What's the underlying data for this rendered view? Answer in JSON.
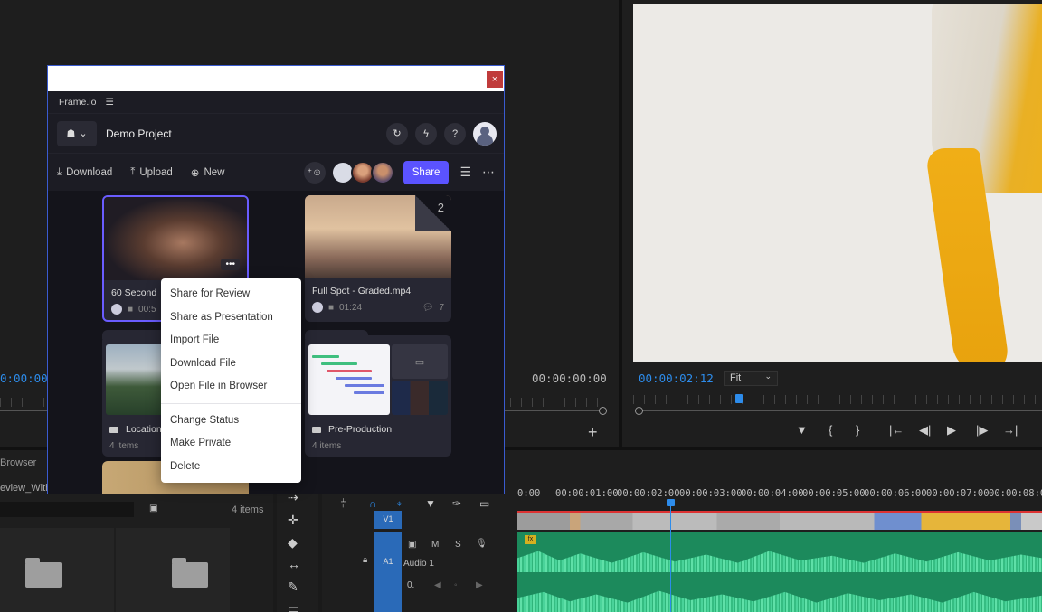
{
  "premiere": {
    "source_timecode": "0:00:00",
    "source_end_timecode": "00:00:00:00",
    "program_timecode": "00:00:02:12",
    "fit_label": "Fit",
    "project_tab": "Browser",
    "project_file": "eview_With",
    "project_count": "4 items",
    "track_v1": "V1",
    "track_a1": "A1",
    "audio_label": "Audio 1",
    "track_m": "M",
    "track_s": "S",
    "fx_label": "fx",
    "ruler": [
      "0:00",
      "00:00:01:00",
      "00:00:02:00",
      "00:00:03:00",
      "00:00:04:00",
      "00:00:05:00",
      "00:00:06:00",
      "00:00:07:00",
      "00:00:08:00"
    ]
  },
  "frameio": {
    "app_name": "Frame.io",
    "project_name": "Demo Project",
    "toolbar": {
      "download": "Download",
      "upload": "Upload",
      "new": "New",
      "share": "Share"
    },
    "cards": [
      {
        "title": "60 Second",
        "duration": "00:5"
      },
      {
        "title": "Full Spot - Graded.mp4",
        "duration": "01:24",
        "comments": "7",
        "version": "2"
      }
    ],
    "folders": [
      {
        "name": "Location",
        "count": "4 items"
      },
      {
        "name": "Pre-Production",
        "count": "4 items"
      }
    ],
    "context_menu": {
      "group1": [
        "Share for Review",
        "Share as Presentation",
        "Import File",
        "Download File",
        "Open File in Browser"
      ],
      "group2": [
        "Change Status",
        "Make Private",
        "Delete"
      ]
    },
    "close_label": "×"
  }
}
